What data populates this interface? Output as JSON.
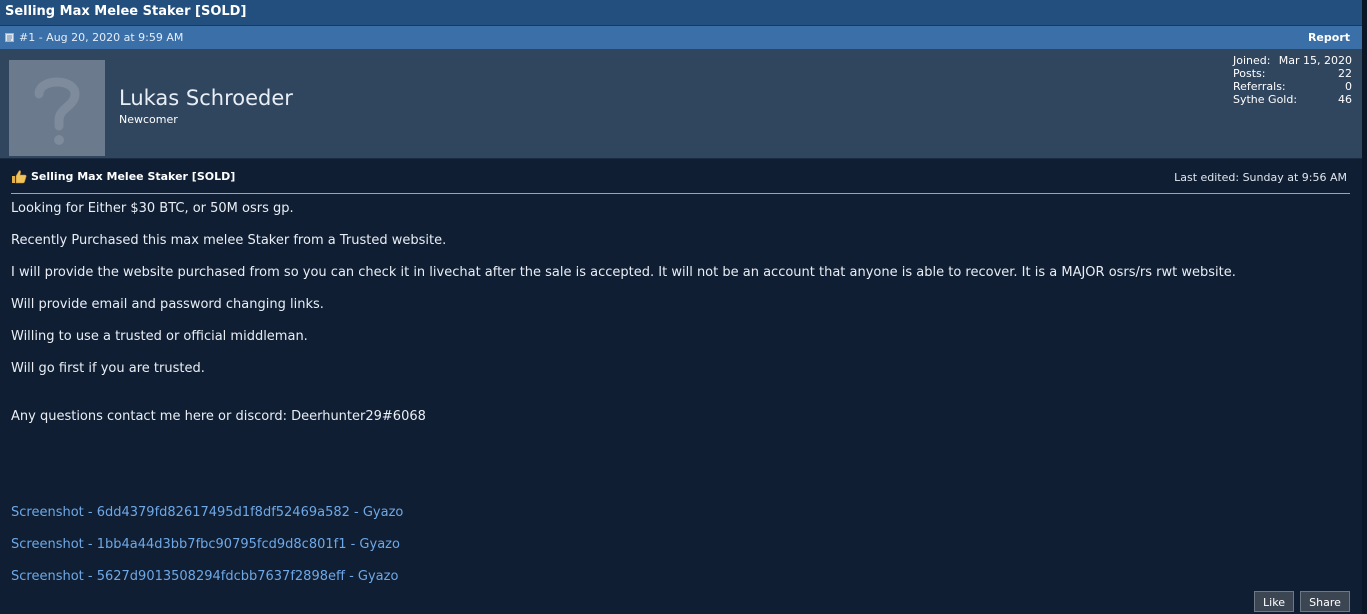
{
  "thread": {
    "title": "Selling Max Melee Staker [SOLD]"
  },
  "post_meta": {
    "label": "#1 - Aug 20, 2020 at 9:59 AM",
    "report_label": "Report"
  },
  "author": {
    "name": "Lukas Schroeder",
    "rank": "Newcomer",
    "stats": [
      {
        "label": "Joined:",
        "value": "Mar 15, 2020"
      },
      {
        "label": "Posts:",
        "value": "22"
      },
      {
        "label": "Referrals:",
        "value": "0"
      },
      {
        "label": "Sythe Gold:",
        "value": "46"
      }
    ]
  },
  "post": {
    "title": "Selling Max Melee Staker [SOLD]",
    "last_edited": "Last edited: Sunday at 9:56 AM",
    "lines": [
      "Looking for Either $30 BTC, or 50M osrs gp.",
      "Recently Purchased this max melee Staker from a Trusted website.",
      "I will provide the website purchased from so you can check it in livechat after the sale is accepted. It will not be an account that anyone is able to recover. It is a MAJOR osrs/rs rwt website.",
      "Will provide email and password changing links.",
      "Willing to use a trusted or official middleman.",
      "Will go first if you are trusted.",
      "Any questions contact me here or discord: Deerhunter29#6068"
    ],
    "links": [
      "Screenshot - 6dd4379fd82617495d1f8df52469a582 - Gyazo",
      "Screenshot - 1bb4a44d3bb7fbc90795fcd9d8c801f1 - Gyazo",
      "Screenshot - 5627d9013508294fdcbb7637f2898eff - Gyazo"
    ]
  },
  "actions": {
    "like_label": "Like",
    "share_label": "Share"
  },
  "colors": {
    "page_bg": "#0f1e33",
    "title_bar": "#234f7f",
    "meta_bar": "#3a6fa8",
    "profile_bg": "#30455e",
    "link": "#6fa8e6"
  }
}
